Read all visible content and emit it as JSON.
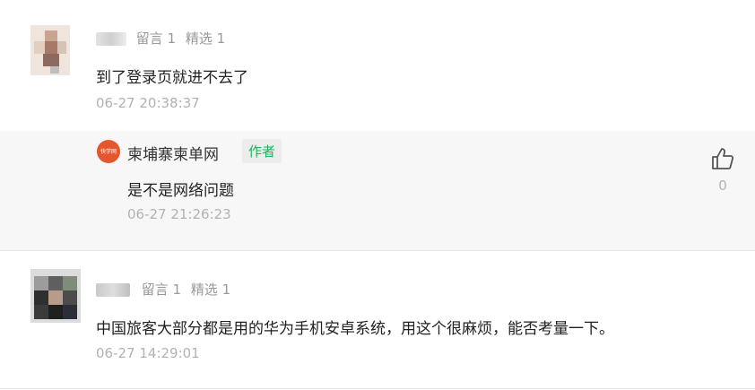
{
  "comments": [
    {
      "name": "·气",
      "reply_count": "留言 1",
      "featured": "精选 1",
      "text": "到了登录页就进不去了",
      "time": "06-27 20:38:37",
      "reply": {
        "logo_text": "快学网",
        "author": "柬埔寨柬单网",
        "badge": "作者",
        "text": "是不是网络问题",
        "time": "06-27 21:26:23",
        "likes": "0",
        "like_icon": "thumbs-up-icon"
      }
    },
    {
      "name": "陈宇",
      "reply_count": "留言 1",
      "featured": "精选 1",
      "text": "中国旅客大部分都是用的华为手机安卓系统，用这个很麻烦，能否考量一下。",
      "time": "06-27 14:29:01"
    }
  ],
  "colors": {
    "badge_text": "#20b25a",
    "reply_bg": "#f7f7f7",
    "logo_bg": "#e4572e",
    "muted_text": "#999999"
  }
}
